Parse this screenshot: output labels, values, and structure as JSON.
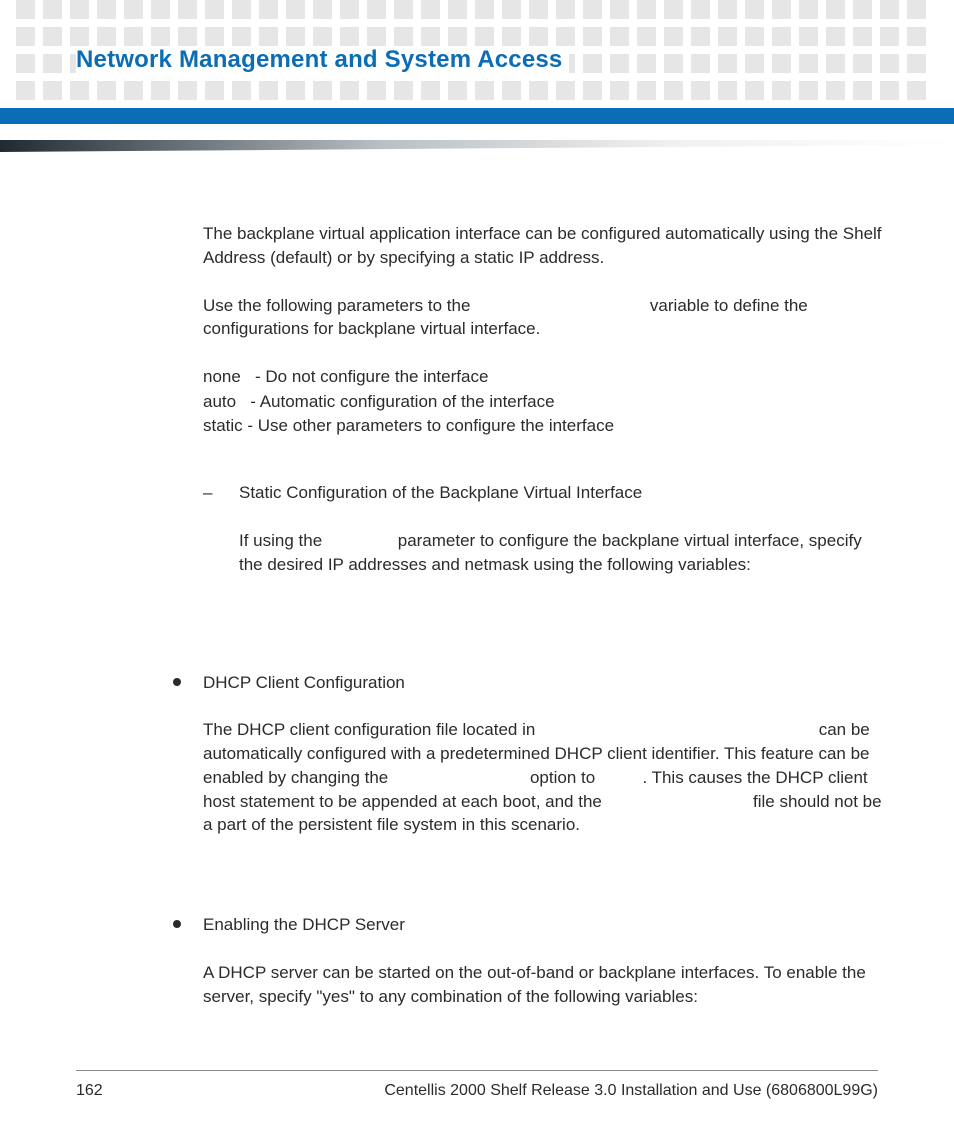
{
  "header": {
    "title": "Network Management and System Access"
  },
  "body": {
    "p1": "The backplane virtual application interface can be configured automatically using the Shelf Address (default) or by specifying a static IP address.",
    "p2_a": "Use the following parameters to the ",
    "p2_b": " variable to define the configurations for backplane virtual interface.",
    "params": {
      "none": "none   - Do not configure the interface",
      "auto": "auto   - Automatic configuration of the interface",
      "static": "static - Use other parameters to configure the interface"
    },
    "dash": {
      "marker": "–",
      "head": "Static Configuration of the Backplane Virtual Interface",
      "p_a": "If using the ",
      "p_b": " parameter to configure the backplane virtual interface, specify the desired IP addresses and netmask using the following variables:"
    },
    "bullet1": {
      "head": "DHCP Client Configuration",
      "p_a": "The DHCP client configuration file located in ",
      "p_b": " can be automatically configured with a predetermined DHCP client identifier. This feature can be enabled by changing the ",
      "p_c": " option to ",
      "p_d": ". This causes the DHCP client host statement to be appended at each boot, and the ",
      "p_e": " file should not be a part of the persistent file system in this scenario."
    },
    "bullet2": {
      "head": "Enabling the DHCP Server",
      "p": "A DHCP server can be started on the out-of-band or backplane interfaces. To enable the server, specify \"yes\" to any combination of the following variables:"
    }
  },
  "footer": {
    "page": "162",
    "doc": "Centellis 2000 Shelf Release 3.0 Installation and Use (6806800L99G)"
  }
}
